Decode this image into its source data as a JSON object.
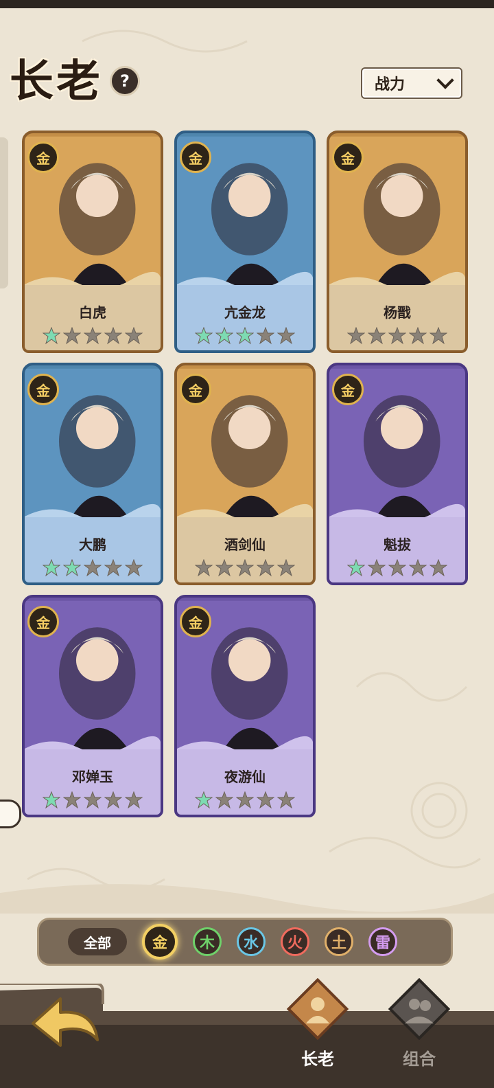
{
  "header": {
    "title": "长老",
    "help_symbol": "?"
  },
  "sort": {
    "label": "战力"
  },
  "cards": [
    {
      "name": "白虎",
      "element": "金",
      "rarity": "gold",
      "stars_filled": 1
    },
    {
      "name": "亢金龙",
      "element": "金",
      "rarity": "blue",
      "stars_filled": 3
    },
    {
      "name": "杨戬",
      "element": "金",
      "rarity": "gold",
      "stars_filled": 0
    },
    {
      "name": "大鹏",
      "element": "金",
      "rarity": "blue",
      "stars_filled": 2
    },
    {
      "name": "酒剑仙",
      "element": "金",
      "rarity": "gold",
      "stars_filled": 0
    },
    {
      "name": "魁拔",
      "element": "金",
      "rarity": "purple",
      "stars_filled": 1
    },
    {
      "name": "邓婵玉",
      "element": "金",
      "rarity": "purple",
      "stars_filled": 1
    },
    {
      "name": "夜游仙",
      "element": "金",
      "rarity": "purple",
      "stars_filled": 1
    }
  ],
  "star_max": 5,
  "filter": {
    "all_label": "全部",
    "elements": [
      {
        "label": "金",
        "color": "#f2cf63",
        "active": true
      },
      {
        "label": "木",
        "color": "#6fd26a",
        "active": false
      },
      {
        "label": "水",
        "color": "#6ac7e6",
        "active": false
      },
      {
        "label": "火",
        "color": "#f06b5e",
        "active": false
      },
      {
        "label": "土",
        "color": "#e0b06a",
        "active": false
      },
      {
        "label": "雷",
        "color": "#d49cf0",
        "active": false
      }
    ]
  },
  "nav": {
    "elders_label": "长老",
    "combo_label": "组合"
  },
  "colors": {
    "star_filled": "#7ddbb2",
    "star_empty": "#8a8278",
    "elem_gold": "#f4cd63"
  }
}
